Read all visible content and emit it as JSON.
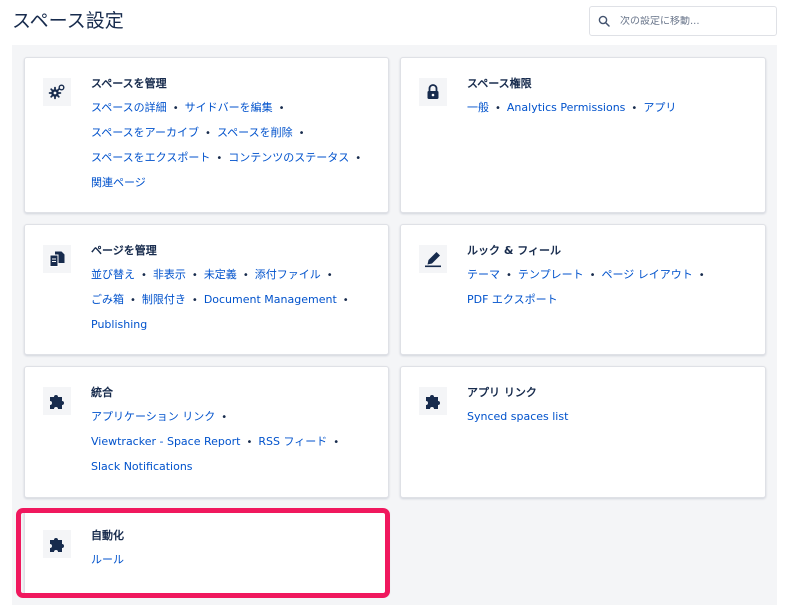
{
  "page": {
    "title": "スペース設定"
  },
  "search": {
    "placeholder": "次の設定に移動..."
  },
  "cards": {
    "manage_space": {
      "title": "スペースを管理",
      "icon": "gear-icon",
      "rows": [
        [
          "スペースの詳細",
          "サイドバーを編集"
        ],
        [
          "スペースをアーカイブ",
          "スペースを削除"
        ],
        [
          "スペースをエクスポート",
          "コンテンツのステータス"
        ],
        [
          "関連ページ"
        ]
      ]
    },
    "space_permissions": {
      "title": "スペース権限",
      "icon": "lock-icon",
      "rows": [
        [
          "一般",
          "Analytics Permissions",
          "アプリ"
        ]
      ]
    },
    "manage_pages": {
      "title": "ページを管理",
      "icon": "pages-icon",
      "rows": [
        [
          "並び替え",
          "非表示",
          "未定義",
          "添付ファイル"
        ],
        [
          "ごみ箱",
          "制限付き",
          "Document Management"
        ],
        [
          "Publishing"
        ]
      ]
    },
    "look_feel": {
      "title": "ルック & フィール",
      "icon": "pencil-icon",
      "rows": [
        [
          "テーマ",
          "テンプレート",
          "ページ レイアウト"
        ],
        [
          "PDF エクスポート"
        ]
      ]
    },
    "integration": {
      "title": "統合",
      "icon": "puzzle-icon",
      "rows": [
        [
          "アプリケーション リンク"
        ],
        [
          "Viewtracker - Space Report",
          "RSS フィード"
        ],
        [
          "Slack Notifications"
        ]
      ]
    },
    "app_links": {
      "title": "アプリ リンク",
      "icon": "puzzle-icon",
      "rows": [
        [
          "Synced spaces list"
        ]
      ]
    },
    "automation": {
      "title": "自動化",
      "icon": "puzzle-icon",
      "rows": [
        [
          "ルール"
        ]
      ]
    }
  },
  "colors": {
    "link": "#0052cc",
    "text": "#172b4d",
    "highlight": "#f0185e",
    "panel": "#f4f5f7"
  }
}
